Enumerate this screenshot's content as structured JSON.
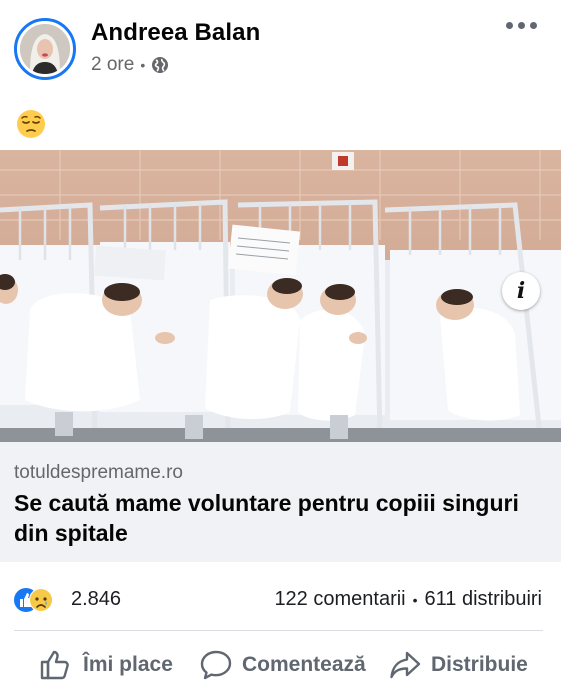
{
  "post": {
    "author": "Andreea Balan",
    "time": "2 ore",
    "separator": "•",
    "privacy_icon": "globe-icon",
    "emoji": "pensive-face",
    "menu_icon": "more-horizontal-icon"
  },
  "link": {
    "domain": "totuldespremame.ro",
    "headline": "Se caută mame voluntare pentru copiii singuri din spitale",
    "info_label": "i"
  },
  "stats": {
    "reactions": [
      "like",
      "sad"
    ],
    "reaction_count": "2.846",
    "comments": "122 comentarii",
    "dot": "•",
    "shares": "611 distribuiri"
  },
  "actions": {
    "like": "Îmi place",
    "comment": "Comentează",
    "share": "Distribuie"
  },
  "colors": {
    "accent": "#1877f2",
    "secondary_text": "#65676b",
    "link_bg": "#f0f2f5"
  }
}
